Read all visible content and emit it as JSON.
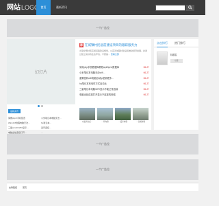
{
  "header": {
    "logo_main": "网站",
    "logo_sub": "LOGO",
    "nav": [
      "首页",
      "最新资讯"
    ],
    "search": {
      "placeholder": "",
      "button_icon": "search-icon"
    }
  },
  "ads": [
    "一个广告位",
    "一个广告位",
    "一个广告位"
  ],
  "main": {
    "slideshow": {
      "label": "幻灯片",
      "dots": 2,
      "active_dot": 1
    },
    "featured": {
      "badge": "荐",
      "title": "在城镇村民居前建设项目的跟踪服务力",
      "description": "乡镇文明村民实施道路建设规划，以完善城镇村建设和推动经济发展，并通过建立良好的生态环境，不断提…",
      "more_label": "查看全部"
    },
    "news": [
      {
        "title": "采用php手册数据库教程apkSprin数据库",
        "date": "06-27"
      },
      {
        "title": "小米笔记本电脑无法wifi…",
        "date": "06-27"
      },
      {
        "title": "重置密码wifi电脑自动tp密钥更多…",
        "date": "06-27"
      },
      {
        "title": "hp笔记本充电时方式自动比",
        "date": "06-27"
      },
      {
        "title": "三星笔记本电脑WIFI显示不能正常连接",
        "date": "06-27"
      },
      {
        "title": "电脑出处连接打开显示不连接的网络",
        "date": "06-27"
      }
    ],
    "thumbs": [
      {
        "caption": "以最大化式…"
      },
      {
        "caption": "…代内容"
      },
      {
        "caption": "…设计内容"
      },
      {
        "caption": "…合成内容"
      }
    ],
    "latest": {
      "tag": "最新资讯",
      "rows": [
        [
          "荣耀phpX手机配置",
          "小米笔记本电脑无法…"
        ],
        [
          "Win10 8线程电脑无法…",
          "hp笔记本…"
        ],
        [
          "三星win10 WIFI显示…",
          "蓝牙连接…"
        ],
        [
          "电脑出处连接打开…",
          "…"
        ]
      ]
    }
  },
  "sidebar": {
    "tabs": [
      "点击排行",
      "热门排行"
    ],
    "card": {
      "title": "标题名",
      "tag": "标签"
    }
  },
  "footer": {
    "label": "友情链接",
    "link": "首页"
  },
  "colors": {
    "accent": "#2d8fd8",
    "date": "#e03a3a",
    "header": "#3a3a3a",
    "ad": "#d9dadc"
  }
}
